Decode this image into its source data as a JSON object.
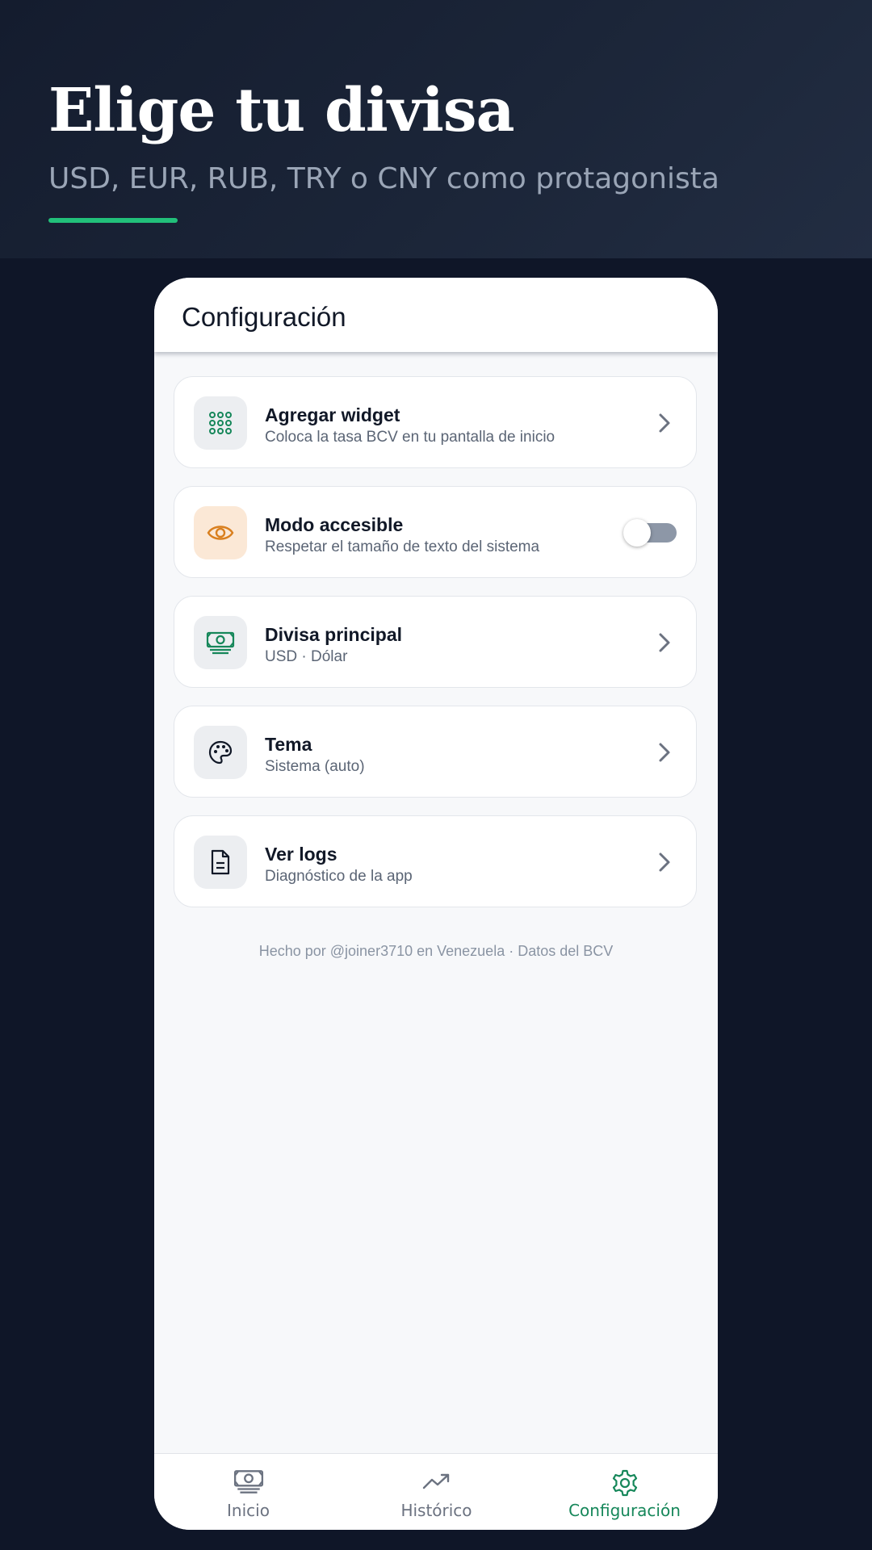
{
  "hero": {
    "title": "Elige tu divisa",
    "subtitle": "USD, EUR, RUB, TRY o CNY como protagonista"
  },
  "appbar": {
    "title": "Configuración"
  },
  "settings": [
    {
      "title": "Agregar widget",
      "subtitle": "Coloca la tasa BCV en tu pantalla de inicio",
      "icon": "grid-dots-icon",
      "control": "chevron"
    },
    {
      "title": "Modo accesible",
      "subtitle": "Respetar el tamaño de texto del sistema",
      "icon": "eye-icon",
      "control": "toggle",
      "enabled": false
    },
    {
      "title": "Divisa principal",
      "subtitle": "USD · Dólar",
      "icon": "banknote-icon",
      "control": "chevron"
    },
    {
      "title": "Tema",
      "subtitle": "Sistema (auto)",
      "icon": "palette-icon",
      "control": "chevron"
    },
    {
      "title": "Ver logs",
      "subtitle": "Diagnóstico de la app",
      "icon": "document-icon",
      "control": "chevron"
    }
  ],
  "footer_note": "Hecho por @joiner3710 en Venezuela · Datos del BCV",
  "nav": [
    {
      "label": "Inicio",
      "icon": "banknote-icon",
      "active": false
    },
    {
      "label": "Histórico",
      "icon": "trend-up-icon",
      "active": false
    },
    {
      "label": "Configuración",
      "icon": "gear-icon",
      "active": true
    }
  ],
  "colors": {
    "background": "#0f1628",
    "accent_green": "#22c07a",
    "active_nav": "#16875a",
    "eye_orange": "#d97f1e"
  }
}
